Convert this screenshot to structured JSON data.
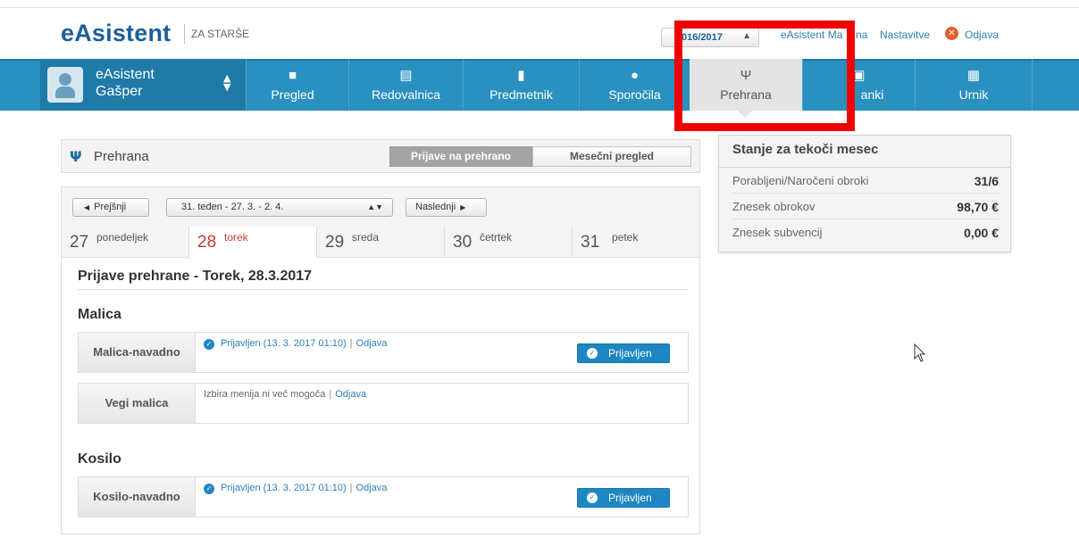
{
  "header": {
    "logo": "eAsistent",
    "logo_sub": "ZA STARŠE",
    "year_select": "016/2017",
    "account_link": "eAsistent Ma",
    "account_link_tail": "na",
    "settings_link": "Nastavitve",
    "logout_link": "Odjava"
  },
  "user": {
    "line1": "eAsistent",
    "line2": "Gašper"
  },
  "nav": [
    {
      "label": "Pregled",
      "icon": "cube-icon"
    },
    {
      "label": "Redovalnica",
      "icon": "id-card-icon"
    },
    {
      "label": "Predmetnik",
      "icon": "book-icon"
    },
    {
      "label": "Sporočila",
      "icon": "chat-icon"
    },
    {
      "label": "Prehrana",
      "icon": "cutlery-icon",
      "active": true
    },
    {
      "label": "anki",
      "icon": "newspaper-icon"
    },
    {
      "label": "Urnik",
      "icon": "calendar-icon"
    }
  ],
  "panel": {
    "title": "Prehrana",
    "seg_active": "Prijave na prehrano",
    "seg_other": "Mesečni pregled"
  },
  "week": {
    "prev": "Prejšnji",
    "select": "31. teden - 27. 3. - 2. 4.",
    "next": "Naslednji"
  },
  "days": [
    {
      "num": "27",
      "name": "ponedeljek"
    },
    {
      "num": "28",
      "name": "torek",
      "active": true
    },
    {
      "num": "29",
      "name": "sreda"
    },
    {
      "num": "30",
      "name": "četrtek"
    },
    {
      "num": "31",
      "name": "petek"
    }
  ],
  "day_title": "Prijave prehrane - Torek, 28.3.2017",
  "meals": {
    "malica_heading": "Malica",
    "kosilo_heading": "Kosilo",
    "rows": [
      {
        "label": "Malica-navadno",
        "status": "Prijavljen (13. 3. 2017 01:10)",
        "sep": "|",
        "action": "Odjava",
        "button": "Prijavljen"
      },
      {
        "label": "Vegi malica",
        "status": "Izbira menija ni več mogoča",
        "sep": "|",
        "action": "Odjava"
      },
      {
        "label": "Kosilo-navadno",
        "status": "Prijavljen (13. 3. 2017 01:10)",
        "sep": "|",
        "action": "Odjava",
        "button": "Prijavljen"
      }
    ]
  },
  "side": {
    "title": "Stanje za tekoči mesec",
    "rows": [
      {
        "label": "Porabljeni/Naročeni obroki",
        "value": "31/6"
      },
      {
        "label": "Znesek obrokov",
        "value": "98,70 €"
      },
      {
        "label": "Znesek subvencij",
        "value": "0,00 €"
      }
    ]
  },
  "colors": {
    "nav": "#2a90c0",
    "brand": "#1b5f9a",
    "highlight": "#f00000",
    "active_day": "#c33a3a"
  }
}
